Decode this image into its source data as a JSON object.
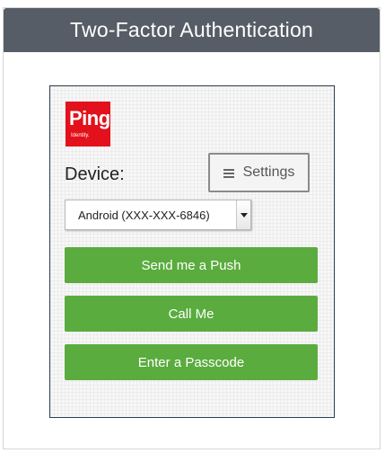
{
  "header": {
    "title": "Two-Factor Authentication"
  },
  "logo": {
    "name": "Ping",
    "tagline": "Identity."
  },
  "device": {
    "label": "Device:",
    "selected": "Android (XXX-XXX-6846)"
  },
  "settings": {
    "label": "Settings"
  },
  "actions": {
    "push": "Send me a Push",
    "call": "Call Me",
    "passcode": "Enter a Passcode"
  },
  "colors": {
    "header_bg": "#565d66",
    "button_green": "#5aac3f",
    "logo_red": "#e3111b",
    "card_border": "#2d3e52"
  }
}
